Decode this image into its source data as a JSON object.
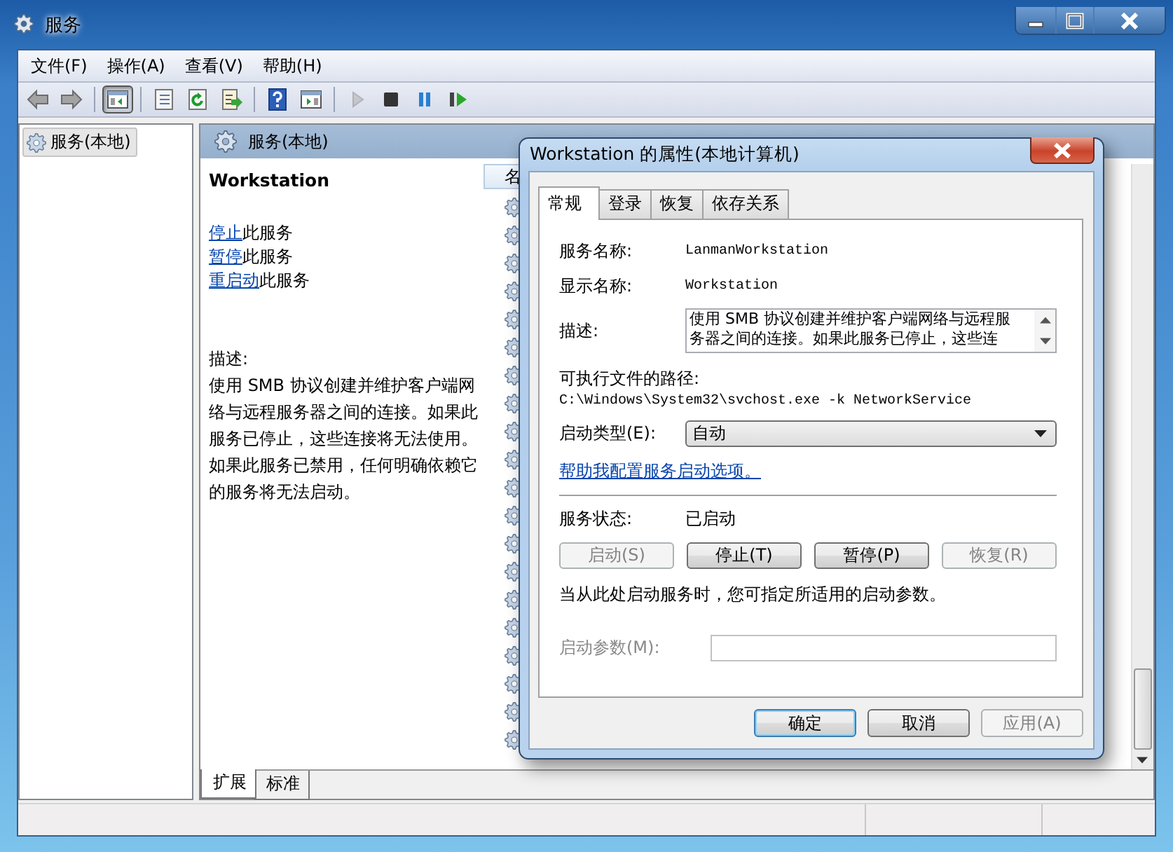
{
  "window": {
    "title": "服务"
  },
  "menu": [
    {
      "label": "文件(F)"
    },
    {
      "label": "操作(A)"
    },
    {
      "label": "查看(V)"
    },
    {
      "label": "帮助(H)"
    }
  ],
  "toolbar": [
    {
      "items": [
        {
          "kind": "back",
          "pressed": false,
          "disabled": false
        },
        {
          "kind": "forward",
          "pressed": false,
          "disabled": false
        }
      ]
    },
    {
      "items": [
        {
          "kind": "console-tree",
          "pressed": true,
          "disabled": false
        }
      ]
    },
    {
      "items": [
        {
          "kind": "properties",
          "pressed": false,
          "disabled": false
        },
        {
          "kind": "refresh",
          "pressed": false,
          "disabled": false
        },
        {
          "kind": "export",
          "pressed": false,
          "disabled": false
        }
      ]
    },
    {
      "items": [
        {
          "kind": "help",
          "pressed": false,
          "disabled": false
        },
        {
          "kind": "action-pane",
          "pressed": false,
          "disabled": false
        }
      ]
    },
    {
      "items": [
        {
          "kind": "play",
          "pressed": false,
          "disabled": true
        },
        {
          "kind": "stop",
          "pressed": false,
          "disabled": false
        },
        {
          "kind": "pause",
          "pressed": false,
          "disabled": false
        },
        {
          "kind": "resume",
          "pressed": false,
          "disabled": false
        }
      ]
    }
  ],
  "tree": {
    "items": [
      {
        "label": "服务(本地)",
        "selected": true
      }
    ]
  },
  "pane": {
    "title": "服务(本地)",
    "service_name": "Workstation",
    "actions": [
      {
        "link": "停止",
        "text": "此服务"
      },
      {
        "link": "暂停",
        "text": "此服务"
      },
      {
        "link": "重启动",
        "text": "此服务"
      }
    ],
    "description_label": "描述:",
    "description": "使用 SMB 协议创建并维护客户端网络与远程服务器之间的连接。如果此服务已停止，这些连接将无法使用。如果此服务已禁用，任何明确依赖它的服务将无法启动。"
  },
  "list": {
    "column_1": "名"
  },
  "view_tabs": [
    {
      "label": "扩展",
      "selected": true
    },
    {
      "label": "标准",
      "selected": false
    }
  ],
  "dialog": {
    "title": "Workstation 的属性(本地计算机)",
    "tabs": [
      {
        "label": "常规",
        "selected": true
      },
      {
        "label": "登录",
        "selected": false
      },
      {
        "label": "恢复",
        "selected": false
      },
      {
        "label": "依存关系",
        "selected": false
      }
    ],
    "service_name": {
      "label": "服务名称:",
      "value": "LanmanWorkstation"
    },
    "display_name": {
      "label": "显示名称:",
      "value": "Workstation"
    },
    "description": {
      "label": "描述:",
      "value": "使用 SMB 协议创建并维护客户端网络与远程服务器之间的连接。如果此服务已停止，这些连"
    },
    "path": {
      "label": "可执行文件的路径:",
      "value": "C:\\Windows\\System32\\svchost.exe -k NetworkService"
    },
    "startup_type": {
      "label": "启动类型(E):",
      "value": "自动"
    },
    "help_link": "帮助我配置服务启动选项。",
    "status": {
      "label": "服务状态:",
      "value": "已启动"
    },
    "service_buttons": [
      {
        "label": "启动(S)",
        "disabled": true
      },
      {
        "label": "停止(T)",
        "disabled": false
      },
      {
        "label": "暂停(P)",
        "disabled": false
      },
      {
        "label": "恢复(R)",
        "disabled": true
      }
    ],
    "hint": "当从此处启动服务时，您可指定所适用的启动参数。",
    "parameters": {
      "label": "启动参数(M):",
      "disabled": true
    },
    "buttons": [
      {
        "label": "确定",
        "default": true,
        "disabled": false
      },
      {
        "label": "取消",
        "default": false,
        "disabled": false
      },
      {
        "label": "应用(A)",
        "default": false,
        "disabled": true
      }
    ]
  }
}
